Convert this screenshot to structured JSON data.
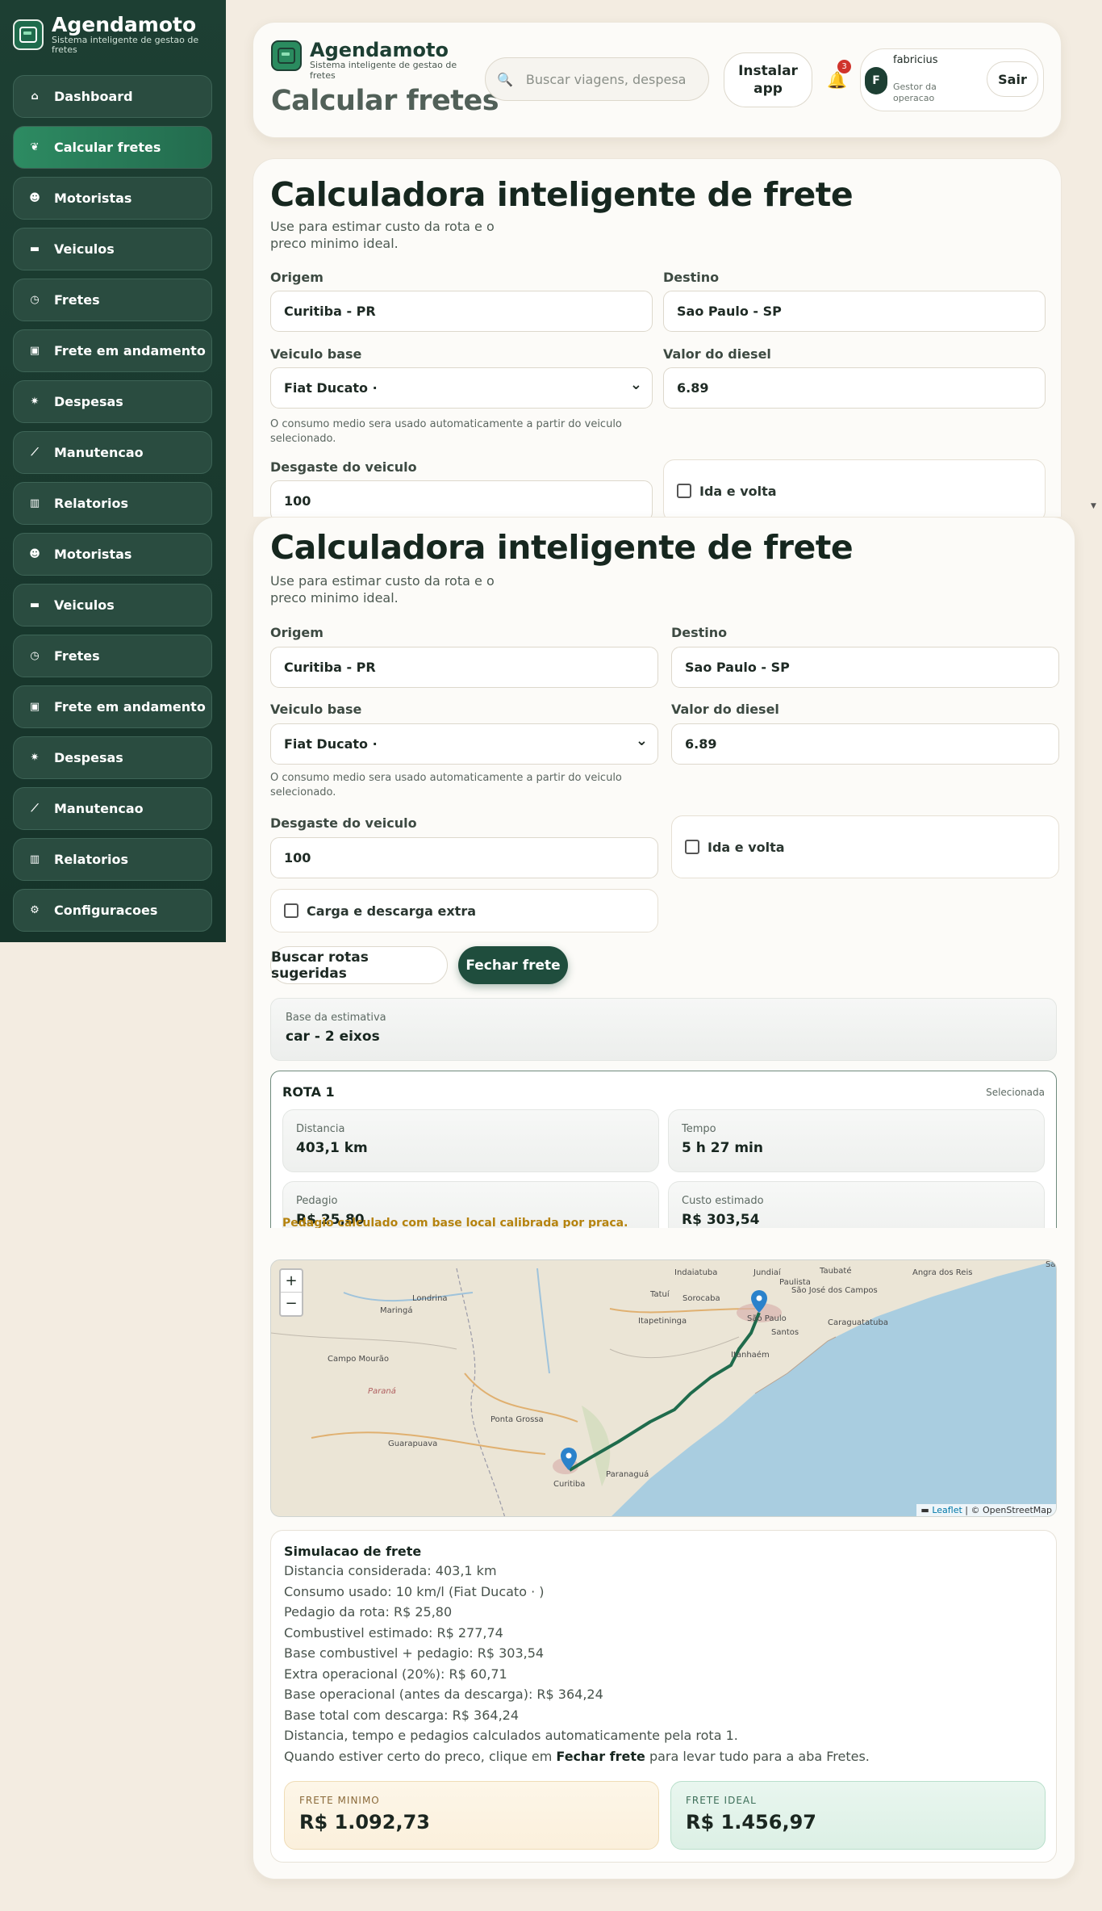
{
  "app": {
    "name": "Agendamoto",
    "tagline": "Sistema inteligente de gestao de fretes"
  },
  "sidebar": {
    "items": [
      {
        "label": "Dashboard",
        "icon": "home-icon"
      },
      {
        "label": "Calcular fretes",
        "icon": "brain-icon",
        "active": true
      },
      {
        "label": "Motoristas",
        "icon": "face-icon"
      },
      {
        "label": "Veiculos",
        "icon": "truck-icon"
      },
      {
        "label": "Fretes",
        "icon": "clock-icon"
      },
      {
        "label": "Frete em andamento",
        "icon": "package-icon"
      },
      {
        "label": "Despesas",
        "icon": "burst-icon"
      },
      {
        "label": "Manutencao",
        "icon": "wand-icon"
      },
      {
        "label": "Relatorios",
        "icon": "chart-icon"
      },
      {
        "label": "Motoristas",
        "icon": "face-icon"
      },
      {
        "label": "Veiculos",
        "icon": "truck-icon"
      },
      {
        "label": "Fretes",
        "icon": "clock-icon"
      },
      {
        "label": "Frete em andamento",
        "icon": "package-icon"
      },
      {
        "label": "Despesas",
        "icon": "burst-icon"
      },
      {
        "label": "Manutencao",
        "icon": "wand-icon"
      },
      {
        "label": "Relatorios",
        "icon": "chart-icon"
      },
      {
        "label": "Configuracoes",
        "icon": "gear-icon"
      }
    ]
  },
  "header": {
    "page_title": "Calcular fretes",
    "search_placeholder": "Buscar viagens, despesa",
    "install_label": "Instalar app",
    "notifications": "3",
    "user_initial": "F",
    "user_name": "fabricius",
    "user_role": "Gestor da operacao",
    "logout_label": "Sair"
  },
  "calculator": {
    "title": "Calculadora inteligente de frete",
    "subtitle": "Use para estimar custo da rota e o preco minimo ideal.",
    "origin_label": "Origem",
    "origin_value": "Curitiba - PR",
    "destination_label": "Destino",
    "destination_value": "Sao Paulo - SP",
    "vehicle_label": "Veiculo base",
    "vehicle_value": "Fiat Ducato ·",
    "diesel_label": "Valor do diesel",
    "diesel_value": "6.89",
    "vehicle_hint": "O consumo medio sera usado automaticamente a partir do veiculo selecionado.",
    "wear_label": "Desgaste do veiculo",
    "wear_value": "100",
    "round_trip_label": "Ida e volta",
    "extra_load_label": "Carga e descarga extra",
    "suggest_routes_label": "Buscar rotas sugeridas",
    "close_freight_label": "Fechar frete",
    "estimate_base_label": "Base da estimativa",
    "estimate_base_value": "car - 2 eixos",
    "route": {
      "name": "ROTA 1",
      "status": "Selecionada",
      "distance_label": "Distancia",
      "distance_value": "403,1 km",
      "time_label": "Tempo",
      "time_value": "5 h 27 min",
      "toll_label": "Pedagio",
      "toll_value": "R$ 25,80",
      "cost_label": "Custo estimado",
      "cost_value": "R$ 303,54",
      "note": "Pedagio calculado com base local calibrada por praca."
    }
  },
  "map": {
    "zoom_in": "+",
    "zoom_out": "−",
    "attribution_leaflet": "Leaflet",
    "attribution_osm": "| © OpenStreetMap",
    "places": [
      "Jundiaí",
      "Taubaté",
      "Indaiatuba",
      "Paulista",
      "São José dos Campos",
      "Angra dos Reis",
      "Tatuí",
      "Sorocaba",
      "São Paulo",
      "Caraguatatuba",
      "Itapetininga",
      "Santos",
      "Itanhaém",
      "Maringá",
      "Londrina",
      "Campo Mourão",
      "Paraná",
      "Ponta Grossa",
      "Guarapuava",
      "Curitiba",
      "Paranaguá",
      "rana",
      "Sa"
    ]
  },
  "simulation": {
    "title": "Simulacao de frete",
    "lines": [
      "Distancia considerada: 403,1 km",
      "Consumo usado: 10 km/l (Fiat Ducato ·              )",
      "Pedagio da rota: R$ 25,80",
      "Combustivel estimado: R$ 277,74",
      "Base combustivel + pedagio: R$ 303,54",
      "Extra operacional (20%): R$ 60,71",
      "Base operacional (antes da descarga): R$ 364,24",
      "Base total com descarga: R$ 364,24",
      "Distancia, tempo e pedagios calculados automaticamente pela rota 1."
    ],
    "final_prefix": "Quando estiver certo do preco, clique em ",
    "final_bold": "Fechar frete",
    "final_suffix": " para levar tudo para a aba Fretes.",
    "min_label": "FRETE MINIMO",
    "min_value": "R$ 1.092,73",
    "ideal_label": "FRETE IDEAL",
    "ideal_value": "R$ 1.456,97"
  },
  "colors": {
    "sidebar": "#1d3f33",
    "accent": "#1f4d3d",
    "route": "#1f6b4c",
    "sea": "#a9cde0"
  }
}
